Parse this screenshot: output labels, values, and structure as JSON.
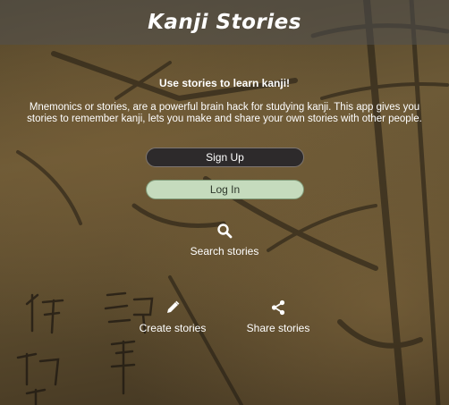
{
  "header": {
    "title": "Kanji Stories"
  },
  "main": {
    "headline": "Use stories to learn kanji!",
    "intro": "Mnemonics or stories, are a powerful brain hack for studying kanji. This app gives you stories to remember kanji, lets you make and share your own stories with other people.",
    "signup_label": "Sign Up",
    "login_label": "Log In"
  },
  "features": {
    "search": {
      "label": "Search stories",
      "icon": "search-icon"
    },
    "create": {
      "label": "Create stories",
      "icon": "pencil-icon"
    },
    "share": {
      "label": "Share stories",
      "icon": "share-icon"
    }
  },
  "colors": {
    "header_bg": "#505050",
    "signup_bg": "#2d2a2b",
    "login_bg": "#c5dbbd"
  }
}
